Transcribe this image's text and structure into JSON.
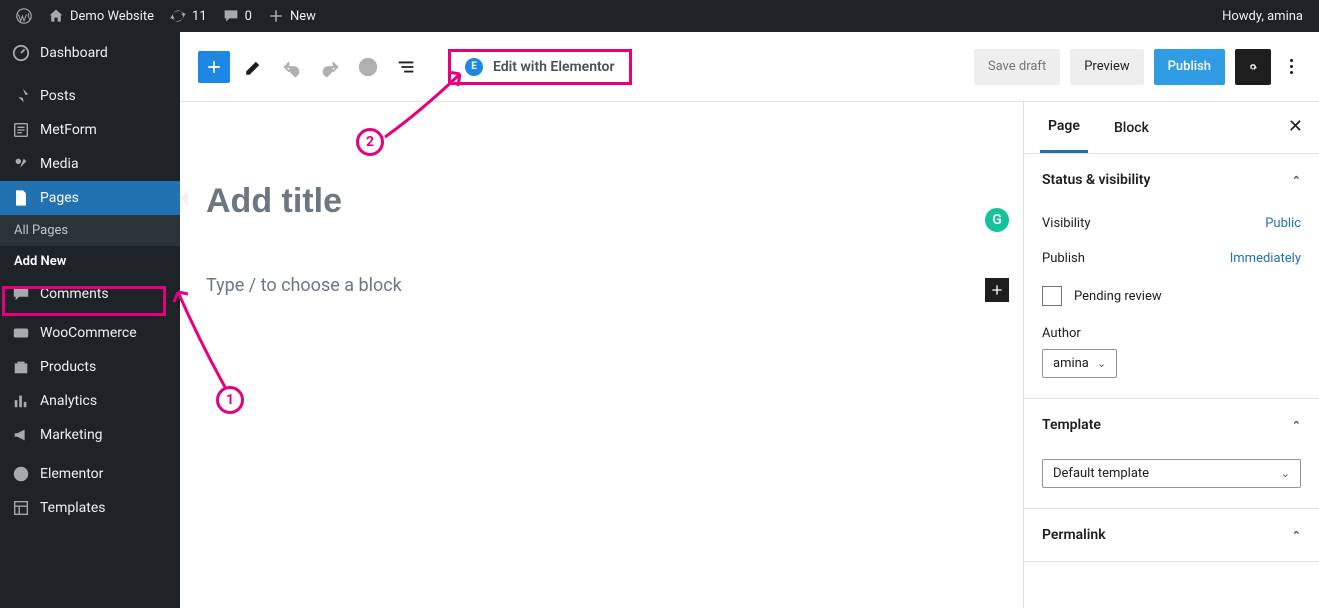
{
  "adminbar": {
    "site_title": "Demo Website",
    "updates_count": "11",
    "comments_count": "0",
    "new_label": "New",
    "howdy": "Howdy, amina"
  },
  "sidebar": {
    "items": [
      {
        "id": "dashboard",
        "label": "Dashboard"
      },
      {
        "id": "posts",
        "label": "Posts"
      },
      {
        "id": "metform",
        "label": "MetForm"
      },
      {
        "id": "media",
        "label": "Media"
      },
      {
        "id": "pages",
        "label": "Pages",
        "active": true
      },
      {
        "id": "comments",
        "label": "Comments"
      },
      {
        "id": "woocommerce",
        "label": "WooCommerce"
      },
      {
        "id": "products",
        "label": "Products"
      },
      {
        "id": "analytics",
        "label": "Analytics"
      },
      {
        "id": "marketing",
        "label": "Marketing"
      },
      {
        "id": "elementor",
        "label": "Elementor"
      },
      {
        "id": "templates",
        "label": "Templates"
      }
    ],
    "pages_submenu": {
      "all_pages": "All Pages",
      "add_new": "Add New"
    }
  },
  "toolbar": {
    "elementor_label": "Edit with Elementor",
    "save_draft": "Save draft",
    "preview": "Preview",
    "publish": "Publish"
  },
  "canvas": {
    "title_placeholder": "Add title",
    "block_placeholder": "Type / to choose a block",
    "grammarly_badge": "G"
  },
  "inspector": {
    "tab_page": "Page",
    "tab_block": "Block",
    "status_panel": {
      "title": "Status & visibility",
      "visibility_label": "Visibility",
      "visibility_value": "Public",
      "publish_label": "Publish",
      "publish_value": "Immediately",
      "pending_review": "Pending review",
      "author_label": "Author",
      "author_value": "amina"
    },
    "template_panel": {
      "title": "Template",
      "value": "Default template"
    },
    "permalink_panel": {
      "title": "Permalink"
    }
  },
  "annotations": {
    "marker1": "1",
    "marker2": "2"
  }
}
